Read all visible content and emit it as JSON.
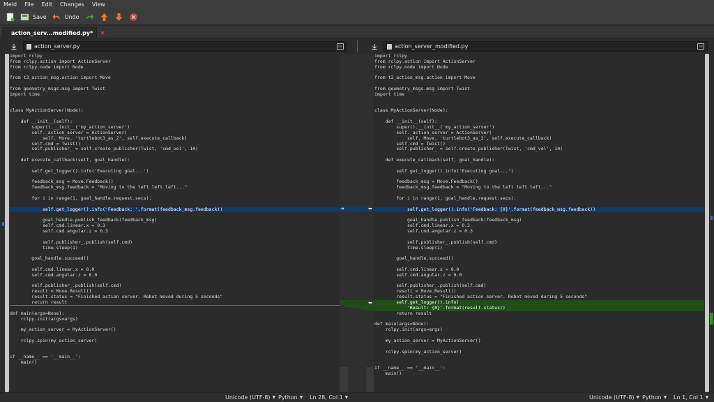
{
  "menu": [
    "Meld",
    "File",
    "Edit",
    "Changes",
    "View"
  ],
  "toolbar": {
    "save_label": "Save",
    "undo_label": "Undo",
    "icons": [
      "new-comparison-icon",
      "save-icon",
      "undo-icon",
      "redo-icon",
      "previous-change-icon",
      "next-change-icon",
      "stop-icon"
    ]
  },
  "tab": {
    "title": "action_serv...modified.py*",
    "close": "×"
  },
  "left": {
    "filename": "action_server.py",
    "lines": [
      "import rclpy",
      "from rclpy.action import ActionServer",
      "from rclpy.node import Node",
      "",
      "from t3_action_msg.action import Move",
      "",
      "from geometry_msgs.msg import Twist",
      "import time",
      "",
      "",
      "class MyActionServer(Node):",
      "",
      "    def __init__(self):",
      "        super().__init__('my_action_server')",
      "        self._action_server = ActionServer(",
      "            self, Move, 'turtlebot3_as_2', self.execute_callback)",
      "        self.cmd = Twist()",
      "        self.publisher_ = self.create_publisher(Twist, 'cmd_vel', 10)",
      "",
      "    def execute_callback(self, goal_handle):",
      "",
      "        self.get_logger().info('Executing goal...')",
      "",
      "        feedback_msg = Move.Feedback()",
      "        feedback_msg.feedback = \"Moving to the left left left...\"",
      "",
      "        for i in range(1, goal_handle.request.secs):",
      "",
      "            self.get_logger().info('Feedback: '.format(feedback_msg.feedback))",
      "",
      "            goal_handle.publish_feedback(feedback_msg)",
      "            self.cmd.linear.x = 0.3",
      "            self.cmd.angular.z = 0.3",
      "",
      "            self.publisher_.publish(self.cmd)",
      "            time.sleep(1)",
      "",
      "        goal_handle.succeed()",
      "",
      "        self.cmd.linear.x = 0.0",
      "        self.cmd.angular.z = 0.0",
      "",
      "        self.publisher_.publish(self.cmd)",
      "        result = Move.Result()",
      "        result.status = \"Finished action server. Robot moved during 5 seconds\"",
      "        return result",
      "",
      "def main(args=None):",
      "    rclpy.init(args=args)",
      "",
      "    my_action_server = MyActionServer()",
      "",
      "    rclpy.spin(my_action_server)",
      "",
      "",
      "if __name__ == '__main__':",
      "    main()"
    ]
  },
  "right": {
    "filename": "action_server_modified.py",
    "lines": [
      "import rclpy",
      "from rclpy.action import ActionServer",
      "from rclpy.node import Node",
      "",
      "from t3_action_msg.action import Move",
      "",
      "from geometry_msgs.msg import Twist",
      "import time",
      "",
      "",
      "class MyActionServer(Node):",
      "",
      "    def __init__(self):",
      "        super().__init__('my_action_server')",
      "        self._action_server = ActionServer(",
      "            self, Move, 'turtlebot3_as_2', self.execute_callback)",
      "        self.cmd = Twist()",
      "        self.publisher_ = self.create_publisher(Twist, 'cmd_vel', 10)",
      "",
      "    def execute_callback(self, goal_handle):",
      "",
      "        self.get_logger().info('Executing goal...')",
      "",
      "        feedback_msg = Move.Feedback()",
      "        feedback_msg.feedback = \"Moving to the left left left...\"",
      "",
      "        for i in range(1, goal_handle.request.secs):",
      "",
      "            self.get_logger().info('Feedback: {0}'.format(feedback_msg.feedback))",
      "",
      "            goal_handle.publish_feedback(feedback_msg)",
      "            self.cmd.linear.x = 0.3",
      "            self.cmd.angular.z = 0.3",
      "",
      "            self.publisher_.publish(self.cmd)",
      "            time.sleep(1)",
      "",
      "        goal_handle.succeed()",
      "",
      "        self.cmd.linear.x = 0.0",
      "        self.cmd.angular.z = 0.0",
      "",
      "        self.publisher_.publish(self.cmd)",
      "        result = Move.Result()",
      "        result.status = \"Finished action server. Robot moved during 5 seconds\"",
      "        self.get_logger().info(",
      "            'Result: {0}'.format(result.status))",
      "        return result",
      "",
      "def main(args=None):",
      "    rclpy.init(args=args)",
      "",
      "    my_action_server = MyActionServer()",
      "",
      "    rclpy.spin(my_action_server)",
      "",
      "",
      "if __name__ == '__main__':",
      "    main()"
    ]
  },
  "status": {
    "left": {
      "encoding": "Unicode (UTF-8)",
      "language": "Python",
      "position": "Ln 28, Col 1"
    },
    "right": {
      "encoding": "Unicode (UTF-8)",
      "language": "Python",
      "position": "Ln 1, Col 1"
    }
  },
  "colors": {
    "changed": "#0d3a70",
    "inserted": "#214d19",
    "background": "#2b2b2b"
  }
}
